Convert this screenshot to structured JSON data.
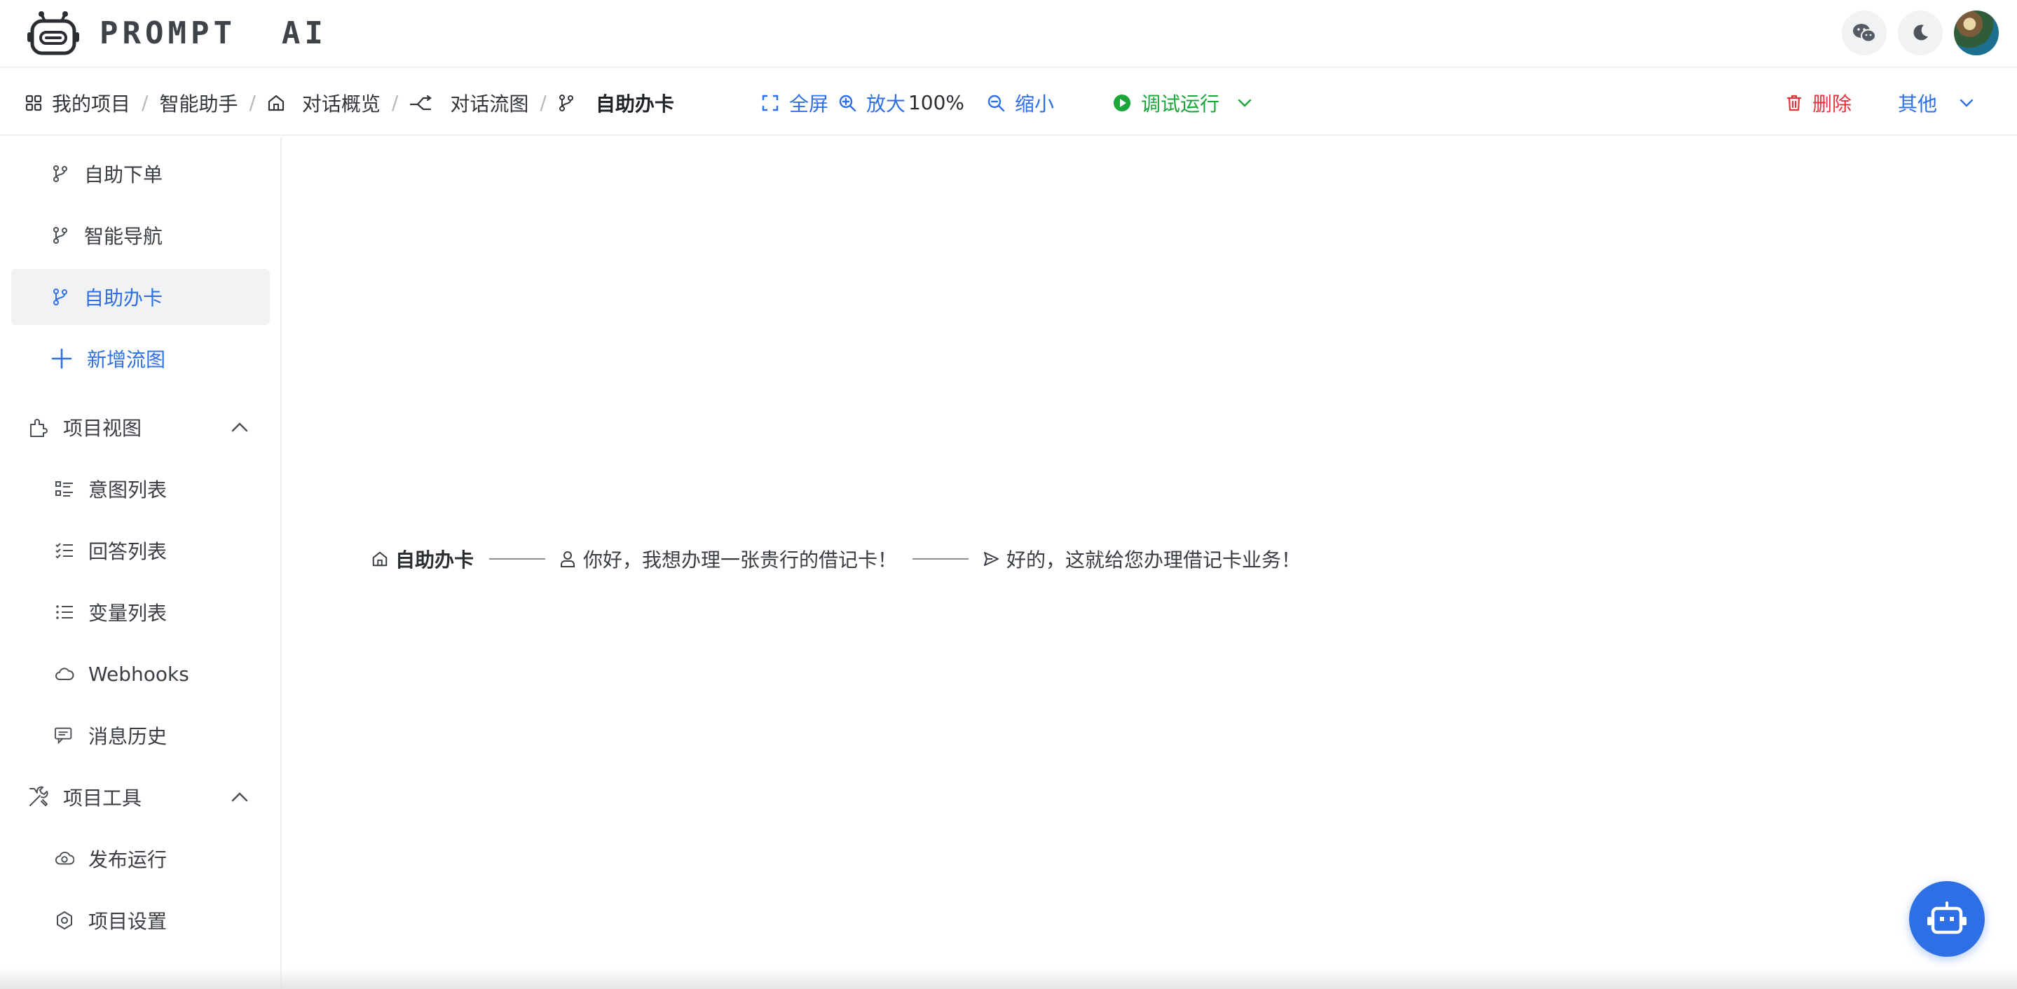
{
  "header": {
    "logo_text": "PROMPT  AI",
    "wechat_icon": "wechat-icon",
    "theme_icon": "moon-icon"
  },
  "breadcrumb": [
    {
      "label": "我的项目",
      "icon": "grid-icon"
    },
    {
      "label": "智能助手",
      "icon": ""
    },
    {
      "label": "对话概览",
      "icon": "home-icon"
    },
    {
      "label": "对话流图",
      "icon": "flow-icon"
    },
    {
      "label": "自助办卡",
      "icon": "branch-icon"
    }
  ],
  "breadcrumb_separator": "/",
  "toolbar": {
    "fullscreen": "全屏",
    "zoom_in": "放大",
    "zoom_level": "100%",
    "zoom_out": "缩小",
    "debug_run": "调试运行",
    "delete": "删除",
    "other": "其他"
  },
  "sidebar": {
    "flows": [
      {
        "label": "自助下单",
        "icon": "branch-icon",
        "active": false
      },
      {
        "label": "智能导航",
        "icon": "branch-icon",
        "active": false
      },
      {
        "label": "自助办卡",
        "icon": "branch-icon",
        "active": true
      }
    ],
    "add_flow": "新增流图",
    "groups": [
      {
        "label": "项目视图",
        "icon": "puzzle-icon",
        "expanded": true,
        "items": [
          {
            "label": "意图列表",
            "icon": "intent-list-icon"
          },
          {
            "label": "回答列表",
            "icon": "checklist-icon"
          },
          {
            "label": "变量列表",
            "icon": "list-icon"
          },
          {
            "label": "Webhooks",
            "icon": "cloud-icon"
          },
          {
            "label": "消息历史",
            "icon": "chat-icon"
          }
        ]
      },
      {
        "label": "项目工具",
        "icon": "tools-icon",
        "expanded": true,
        "items": [
          {
            "label": "发布运行",
            "icon": "cloud-upload-icon"
          },
          {
            "label": "项目设置",
            "icon": "settings-icon"
          }
        ]
      }
    ]
  },
  "flow": {
    "root": "自助办卡",
    "user_message": "你好，我想办理一张贵行的借记卡！",
    "bot_reply": "好的，这就给您办理借记卡业务！"
  },
  "colors": {
    "accent": "#2f6fe6",
    "run": "#1aa63b",
    "danger": "#e1343f"
  }
}
